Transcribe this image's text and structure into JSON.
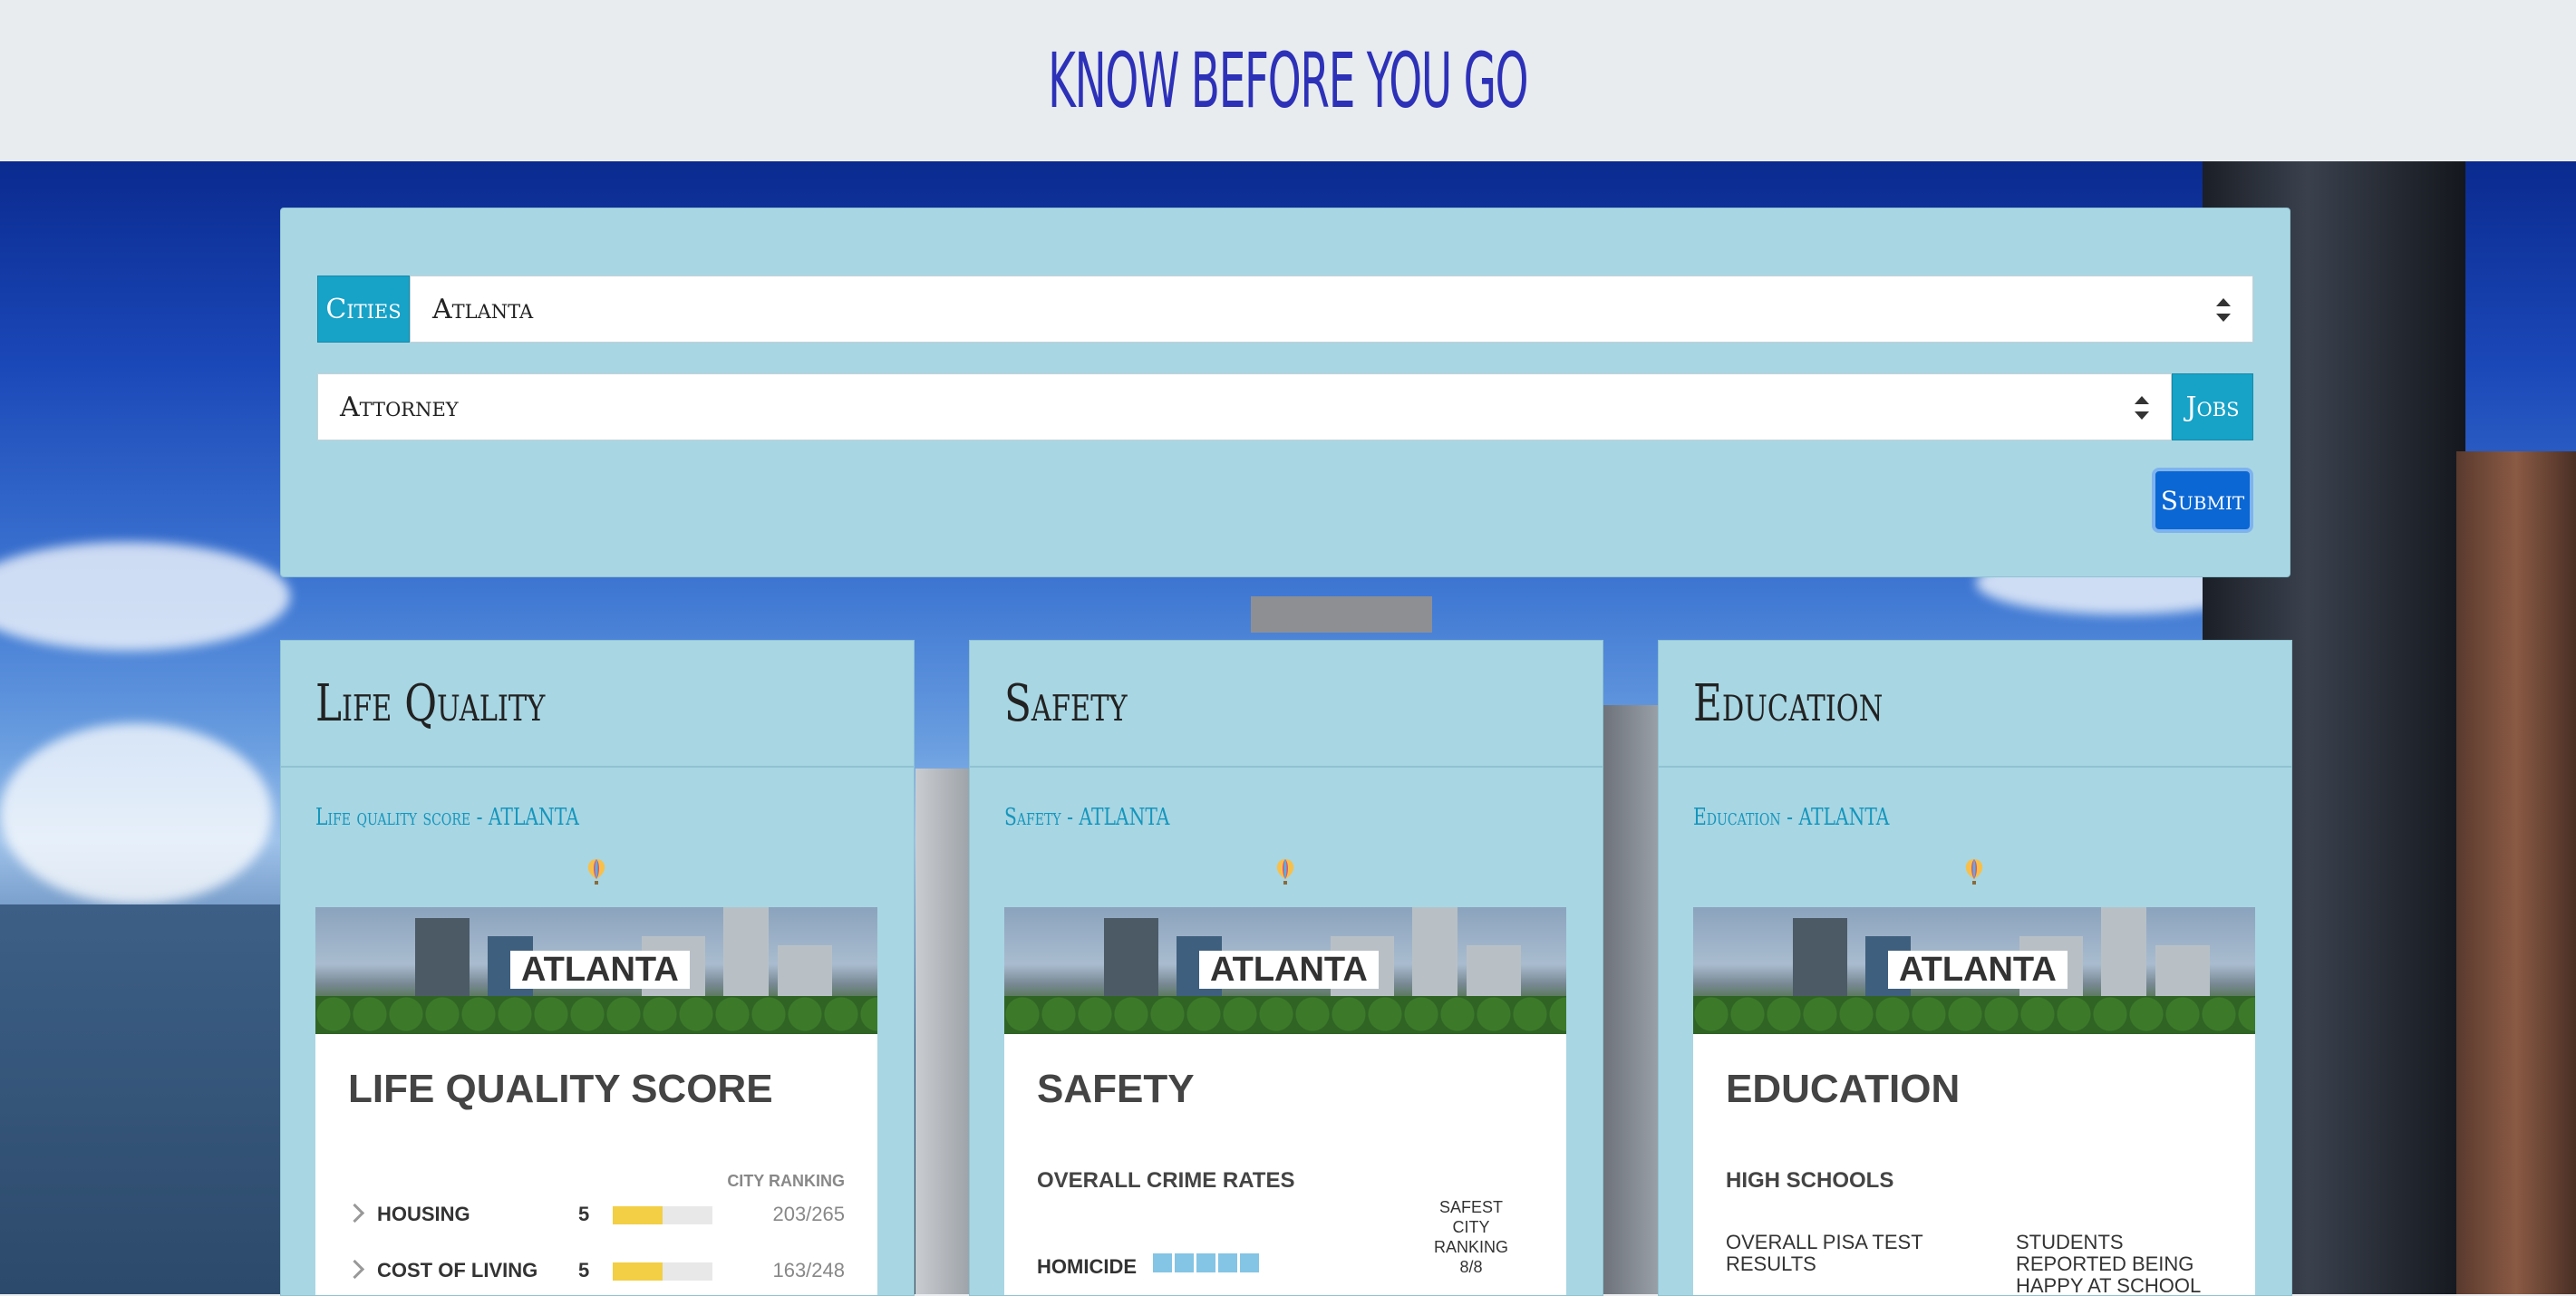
{
  "header": {
    "title": "KNOW BEFORE YOU GO"
  },
  "search": {
    "cities_label": "Cities",
    "city_value": "Atlanta",
    "job_value": "Attorney",
    "jobs_label": "Jobs",
    "submit_label": "Submit"
  },
  "cards": [
    {
      "title": "Life Quality",
      "subtitle": "Life quality score - ATLANTA",
      "city_label": "ATLANTA",
      "body_title": "LIFE QUALITY SCORE",
      "rank_header": "CITY RANKING",
      "rows": [
        {
          "label": "HOUSING",
          "score": "5",
          "score_fraction": 0.5,
          "rank": "203/265"
        },
        {
          "label": "COST OF LIVING",
          "score": "5",
          "score_fraction": 0.5,
          "rank": "163/248"
        }
      ]
    },
    {
      "title": "Safety",
      "subtitle": "Safety - ATLANTA",
      "city_label": "ATLANTA",
      "body_title": "SAFETY",
      "section": "OVERALL CRIME RATES",
      "safest": {
        "l1": "SAFEST",
        "l2": "CITY",
        "l3": "RANKING",
        "value": "8/8"
      },
      "homicide_label": "HOMICIDE",
      "homicide_level": 5
    },
    {
      "title": "Education",
      "subtitle": "Education - ATLANTA",
      "city_label": "ATLANTA",
      "body_title": "EDUCATION",
      "section": "HIGH SCHOOLS",
      "col1": "OVERALL PISA TEST RESULTS",
      "col2": "STUDENTS REPORTED BEING HAPPY AT SCHOOL"
    }
  ],
  "colors": {
    "accent": "#17a2c8",
    "submit": "#0a67d4",
    "title": "#2d31b8",
    "panel": "#a8d6e3"
  }
}
